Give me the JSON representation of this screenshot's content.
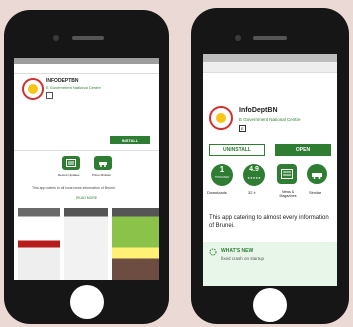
{
  "left": {
    "app_name": "INFODEPTBN",
    "developer": "E Government National Centre",
    "install_label": "INSTALL",
    "tiles": [
      {
        "label": "Recent Updates",
        "icon": "news-icon"
      },
      {
        "label": "Prime Minister",
        "icon": "cars-icon"
      }
    ],
    "description": "This app caters to all local news information of Brunei.",
    "read_more": "READ MORE"
  },
  "right": {
    "app_name": "InfoDeptBN",
    "developer": "E Government National Centre",
    "rating_badge": "E",
    "uninstall_label": "UNINSTALL",
    "open_label": "OPEN",
    "stats": [
      {
        "value": "1",
        "sub": "THOUSAND",
        "label": "Downloads"
      },
      {
        "value": "4.9",
        "sub": "★★★★★",
        "label": "32 ±"
      },
      {
        "value": "",
        "sub": "",
        "label": "News & Magazines"
      },
      {
        "value": "",
        "sub": "",
        "label": "Similar"
      }
    ],
    "description": "This app catering to almost every information of Brunei.",
    "whats_new_title": "WHAT'S NEW",
    "whats_new_text": "fixed crash on startup"
  },
  "colors": {
    "accent": "#2e7d32",
    "background": "#ead9d4",
    "phone": "#161616"
  }
}
